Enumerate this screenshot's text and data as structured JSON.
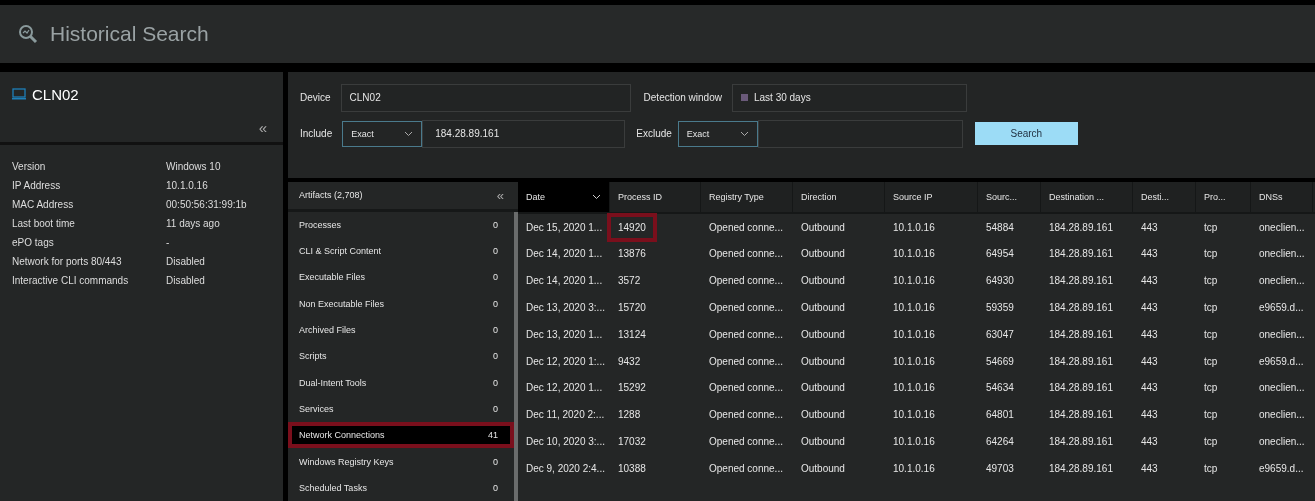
{
  "window": {
    "title": "Historical Search"
  },
  "device_panel": {
    "name": "CLN02",
    "collapse": "«",
    "properties": [
      {
        "label": "Version",
        "value": "Windows 10"
      },
      {
        "label": "IP Address",
        "value": "10.1.0.16"
      },
      {
        "label": "MAC Address",
        "value": "00:50:56:31:99:1b"
      },
      {
        "label": "Last boot time",
        "value": "11 days ago"
      },
      {
        "label": "ePO tags",
        "value": "-"
      },
      {
        "label": "Network for ports 80/443",
        "value": "Disabled"
      },
      {
        "label": "Interactive CLI commands",
        "value": "Disabled"
      }
    ]
  },
  "filters": {
    "device": {
      "label": "Device",
      "value": "CLN02"
    },
    "detection_window": {
      "label": "Detection window",
      "value": "Last 30 days"
    },
    "include": {
      "label": "Include",
      "mode": "Exact",
      "value": "184.28.89.161"
    },
    "exclude": {
      "label": "Exclude",
      "mode": "Exact"
    },
    "search_button": "Search"
  },
  "artifacts": {
    "title": "Artifacts (2,708)",
    "collapse": "«",
    "items": [
      {
        "label": "Processes",
        "count": "0",
        "selected": false,
        "annotated": false
      },
      {
        "label": "CLI & Script Content",
        "count": "0",
        "selected": false,
        "annotated": false
      },
      {
        "label": "Executable Files",
        "count": "0",
        "selected": false,
        "annotated": false
      },
      {
        "label": "Non Executable Files",
        "count": "0",
        "selected": false,
        "annotated": false
      },
      {
        "label": "Archived Files",
        "count": "0",
        "selected": false,
        "annotated": false
      },
      {
        "label": "Scripts",
        "count": "0",
        "selected": false,
        "annotated": false
      },
      {
        "label": "Dual-Intent Tools",
        "count": "0",
        "selected": false,
        "annotated": false
      },
      {
        "label": "Services",
        "count": "0",
        "selected": false,
        "annotated": false
      },
      {
        "label": "Network Connections",
        "count": "41",
        "selected": true,
        "annotated": true
      },
      {
        "label": "Windows Registry Keys",
        "count": "0",
        "selected": false,
        "annotated": false
      },
      {
        "label": "Scheduled Tasks",
        "count": "0",
        "selected": false,
        "annotated": false
      }
    ]
  },
  "table": {
    "columns": [
      {
        "label": "Date",
        "sorted": true
      },
      {
        "label": "Process ID",
        "sorted": false
      },
      {
        "label": "Registry Type",
        "sorted": false
      },
      {
        "label": "Direction",
        "sorted": false
      },
      {
        "label": "Source IP",
        "sorted": false
      },
      {
        "label": "Sourc...",
        "sorted": false
      },
      {
        "label": "Destination ...",
        "sorted": false
      },
      {
        "label": "Desti...",
        "sorted": false
      },
      {
        "label": "Pro...",
        "sorted": false
      },
      {
        "label": "DNSs",
        "sorted": false
      }
    ],
    "rows": [
      {
        "annotated": true,
        "cells": [
          "Dec 15, 2020 1...",
          "14920",
          "Opened conne...",
          "Outbound",
          "10.1.0.16",
          "54884",
          "184.28.89.161",
          "443",
          "tcp",
          "oneclien..."
        ]
      },
      {
        "annotated": false,
        "cells": [
          "Dec 14, 2020 1...",
          "13876",
          "Opened conne...",
          "Outbound",
          "10.1.0.16",
          "64954",
          "184.28.89.161",
          "443",
          "tcp",
          "oneclien..."
        ]
      },
      {
        "annotated": false,
        "cells": [
          "Dec 14, 2020 1...",
          "3572",
          "Opened conne...",
          "Outbound",
          "10.1.0.16",
          "64930",
          "184.28.89.161",
          "443",
          "tcp",
          "oneclien..."
        ]
      },
      {
        "annotated": false,
        "cells": [
          "Dec 13, 2020 3:...",
          "15720",
          "Opened conne...",
          "Outbound",
          "10.1.0.16",
          "59359",
          "184.28.89.161",
          "443",
          "tcp",
          "e9659.d..."
        ]
      },
      {
        "annotated": false,
        "cells": [
          "Dec 13, 2020 1...",
          "13124",
          "Opened conne...",
          "Outbound",
          "10.1.0.16",
          "63047",
          "184.28.89.161",
          "443",
          "tcp",
          "oneclien..."
        ]
      },
      {
        "annotated": false,
        "cells": [
          "Dec 12, 2020 1:...",
          "9432",
          "Opened conne...",
          "Outbound",
          "10.1.0.16",
          "54669",
          "184.28.89.161",
          "443",
          "tcp",
          "e9659.d..."
        ]
      },
      {
        "annotated": false,
        "cells": [
          "Dec 12, 2020 1...",
          "15292",
          "Opened conne...",
          "Outbound",
          "10.1.0.16",
          "54634",
          "184.28.89.161",
          "443",
          "tcp",
          "oneclien..."
        ]
      },
      {
        "annotated": false,
        "cells": [
          "Dec 11, 2020 2:...",
          "1288",
          "Opened conne...",
          "Outbound",
          "10.1.0.16",
          "64801",
          "184.28.89.161",
          "443",
          "tcp",
          "oneclien..."
        ]
      },
      {
        "annotated": false,
        "cells": [
          "Dec 10, 2020 3:...",
          "17032",
          "Opened conne...",
          "Outbound",
          "10.1.0.16",
          "64264",
          "184.28.89.161",
          "443",
          "tcp",
          "oneclien..."
        ]
      },
      {
        "annotated": false,
        "cells": [
          "Dec 9, 2020 2:4...",
          "10388",
          "Opened conne...",
          "Outbound",
          "10.1.0.16",
          "49703",
          "184.28.89.161",
          "443",
          "tcp",
          "e9659.d..."
        ]
      }
    ]
  }
}
